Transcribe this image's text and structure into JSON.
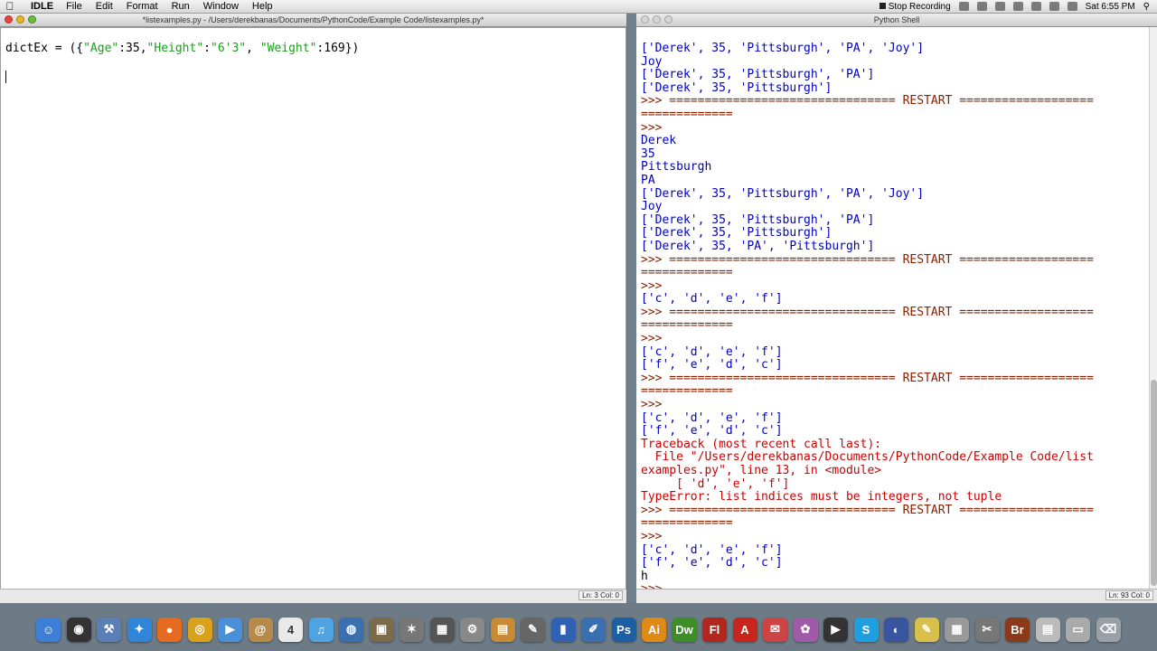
{
  "menubar": {
    "apple_icon": "apple-logo-icon",
    "app_name": "IDLE",
    "menus": [
      "File",
      "Edit",
      "Format",
      "Run",
      "Window",
      "Help"
    ],
    "stop_recording": "Stop Recording",
    "clock": "Sat 6:55 PM"
  },
  "editor": {
    "title": "*listexamples.py - /Users/derekbanas/Documents/PythonCode/Example Code/listexamples.py*",
    "code_prefix": "dictEx = ({",
    "k1": "\"Age\"",
    "v1": ":35,",
    "k2": "\"Height\"",
    "colon2": ":",
    "v2": "\"6'3\"",
    "comma2": ", ",
    "k3": "\"Weight\"",
    "v3": ":169})",
    "status": "Ln: 3 Col: 0"
  },
  "shell": {
    "title": "Python Shell",
    "status": "Ln: 93 Col: 0",
    "lines": [
      {
        "t": "['Derek', 35, 'Pittsburgh', 'PA', 'Joy']",
        "c": "out"
      },
      {
        "t": "Joy",
        "c": "out"
      },
      {
        "t": "['Derek', 35, 'Pittsburgh', 'PA']",
        "c": "out"
      },
      {
        "t": "['Derek', 35, 'Pittsburgh']",
        "c": "out"
      },
      {
        "t": ">>> ================================ RESTART ===================",
        "c": "prompt"
      },
      {
        "t": "=============",
        "c": "prompt"
      },
      {
        "t": ">>>",
        "c": "prompt"
      },
      {
        "t": "Derek",
        "c": "out"
      },
      {
        "t": "35",
        "c": "out"
      },
      {
        "t": "Pittsburgh",
        "c": "out"
      },
      {
        "t": "PA",
        "c": "out"
      },
      {
        "t": "['Derek', 35, 'Pittsburgh', 'PA', 'Joy']",
        "c": "out"
      },
      {
        "t": "Joy",
        "c": "out"
      },
      {
        "t": "['Derek', 35, 'Pittsburgh', 'PA']",
        "c": "out"
      },
      {
        "t": "['Derek', 35, 'Pittsburgh']",
        "c": "out"
      },
      {
        "t": "['Derek', 35, 'PA', 'Pittsburgh']",
        "c": "out"
      },
      {
        "t": ">>> ================================ RESTART ===================",
        "c": "prompt"
      },
      {
        "t": "=============",
        "c": "prompt"
      },
      {
        "t": ">>>",
        "c": "prompt"
      },
      {
        "t": "['c', 'd', 'e', 'f']",
        "c": "out"
      },
      {
        "t": ">>> ================================ RESTART ===================",
        "c": "prompt"
      },
      {
        "t": "=============",
        "c": "prompt"
      },
      {
        "t": ">>>",
        "c": "prompt"
      },
      {
        "t": "['c', 'd', 'e', 'f']",
        "c": "out"
      },
      {
        "t": "['f', 'e', 'd', 'c']",
        "c": "out"
      },
      {
        "t": ">>> ================================ RESTART ===================",
        "c": "prompt"
      },
      {
        "t": "=============",
        "c": "prompt"
      },
      {
        "t": ">>>",
        "c": "prompt"
      },
      {
        "t": "['c', 'd', 'e', 'f']",
        "c": "out"
      },
      {
        "t": "['f', 'e', 'd', 'c']",
        "c": "out"
      },
      {
        "t": "Traceback (most recent call last):",
        "c": "err"
      },
      {
        "t": "  File \"/Users/derekbanas/Documents/PythonCode/Example Code/list",
        "c": "err"
      },
      {
        "t": "examples.py\", line 13, in <module>",
        "c": "err"
      },
      {
        "t": "     [ 'd', 'e', 'f']",
        "c": "err"
      },
      {
        "t": "TypeError: list indices must be integers, not tuple",
        "c": "err"
      },
      {
        "t": ">>> ================================ RESTART ===================",
        "c": "prompt"
      },
      {
        "t": "=============",
        "c": "prompt"
      },
      {
        "t": ">>>",
        "c": "prompt"
      },
      {
        "t": "['c', 'd', 'e', 'f']",
        "c": "out"
      },
      {
        "t": "['f', 'e', 'd', 'c']",
        "c": "out"
      },
      {
        "t": "h",
        "c": "user"
      },
      {
        "t": ">>>",
        "c": "prompt"
      }
    ]
  },
  "dock": {
    "apps": [
      {
        "name": "finder-icon",
        "color": "#3d7fd6",
        "glyph": "☺"
      },
      {
        "name": "dashboard-icon",
        "color": "#333333",
        "glyph": "◉"
      },
      {
        "name": "xcode-icon",
        "color": "#5a7fb6",
        "glyph": "⚒"
      },
      {
        "name": "safari-icon",
        "color": "#2f86d8",
        "glyph": "✦"
      },
      {
        "name": "firefox-icon",
        "color": "#e66a1f",
        "glyph": "●"
      },
      {
        "name": "chrome-icon",
        "color": "#d9a21c",
        "glyph": "◎"
      },
      {
        "name": "facetime-icon",
        "color": "#4a90d9",
        "glyph": "▶"
      },
      {
        "name": "contacts-icon",
        "color": "#b88a4a",
        "glyph": "@"
      },
      {
        "name": "calendar-icon",
        "color": "#e9e9e9",
        "glyph": "4"
      },
      {
        "name": "itunes-icon",
        "color": "#4fa3e0",
        "glyph": "♫"
      },
      {
        "name": "network-icon",
        "color": "#3a6fb0",
        "glyph": "◍"
      },
      {
        "name": "preview-icon",
        "color": "#7b6b4b",
        "glyph": "▣"
      },
      {
        "name": "utility-icon",
        "color": "#777777",
        "glyph": "✶"
      },
      {
        "name": "grid-icon",
        "color": "#555555",
        "glyph": "▦"
      },
      {
        "name": "settings-icon",
        "color": "#888888",
        "glyph": "⚙"
      },
      {
        "name": "archive-icon",
        "color": "#c98a36",
        "glyph": "▤"
      },
      {
        "name": "pen-icon",
        "color": "#666666",
        "glyph": "✎"
      },
      {
        "name": "keynote-icon",
        "color": "#2f62b3",
        "glyph": "▮"
      },
      {
        "name": "editor-icon",
        "color": "#3a6fb0",
        "glyph": "✐"
      },
      {
        "name": "photoshop-icon",
        "color": "#1c5fa5",
        "glyph": "Ps"
      },
      {
        "name": "illustrator-icon",
        "color": "#e08a16",
        "glyph": "Ai"
      },
      {
        "name": "dreamweaver-icon",
        "color": "#3e8e28",
        "glyph": "Dw"
      },
      {
        "name": "flash-icon",
        "color": "#b3261e",
        "glyph": "Fl"
      },
      {
        "name": "acrobat-icon",
        "color": "#c8261c",
        "glyph": "A"
      },
      {
        "name": "mail-icon",
        "color": "#cc4444",
        "glyph": "✉"
      },
      {
        "name": "app-store-icon",
        "color": "#a05aa8",
        "glyph": "✿"
      },
      {
        "name": "film-icon",
        "color": "#333333",
        "glyph": "▶"
      },
      {
        "name": "skype-icon",
        "color": "#1ea0e0",
        "glyph": "S"
      },
      {
        "name": "globe-icon",
        "color": "#3a55a0",
        "glyph": "◐"
      },
      {
        "name": "text-icon",
        "color": "#d8c04a",
        "glyph": "✎"
      },
      {
        "name": "calculator-icon",
        "color": "#999999",
        "glyph": "▦"
      },
      {
        "name": "tools-icon",
        "color": "#777777",
        "glyph": "✂"
      },
      {
        "name": "bridge-icon",
        "color": "#8a3a1a",
        "glyph": "Br"
      },
      {
        "name": "documents-icon",
        "color": "#bbbbbb",
        "glyph": "▤"
      },
      {
        "name": "downloads-icon",
        "color": "#aaaaaa",
        "glyph": "▭"
      },
      {
        "name": "trash-icon",
        "color": "#9aa0a6",
        "glyph": "⌫"
      }
    ]
  }
}
